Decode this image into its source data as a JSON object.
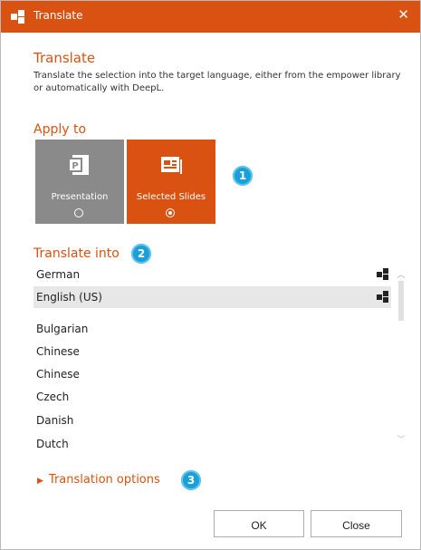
{
  "colors": {
    "accent": "#d95212",
    "tile_inactive": "#8a8a8a",
    "badge": "#1a9fd8"
  },
  "window": {
    "title": "Translate",
    "close_glyph": "✕",
    "app_icon": "empower-icon"
  },
  "header": {
    "title": "Translate",
    "description": "Translate the selection into the target language, either from the empower library or automatically with DeepL."
  },
  "apply_to": {
    "label": "Apply to",
    "options": [
      {
        "label": "Presentation",
        "icon": "powerpoint-icon",
        "selected": false
      },
      {
        "label": "Selected Slides",
        "icon": "slides-icon",
        "selected": true
      }
    ],
    "badge": "1"
  },
  "translate_into": {
    "label": "Translate into",
    "badge": "2",
    "top_languages": [
      {
        "name": "German",
        "icon": "empower-icon",
        "selected": false
      },
      {
        "name": "English (US)",
        "icon": "empower-icon",
        "selected": true
      }
    ],
    "languages": [
      "Bulgarian",
      "Chinese",
      "Chinese",
      "Czech",
      "Danish",
      "Dutch"
    ]
  },
  "options": {
    "label": "Translation options",
    "badge": "3"
  },
  "buttons": {
    "ok": "OK",
    "close": "Close"
  }
}
